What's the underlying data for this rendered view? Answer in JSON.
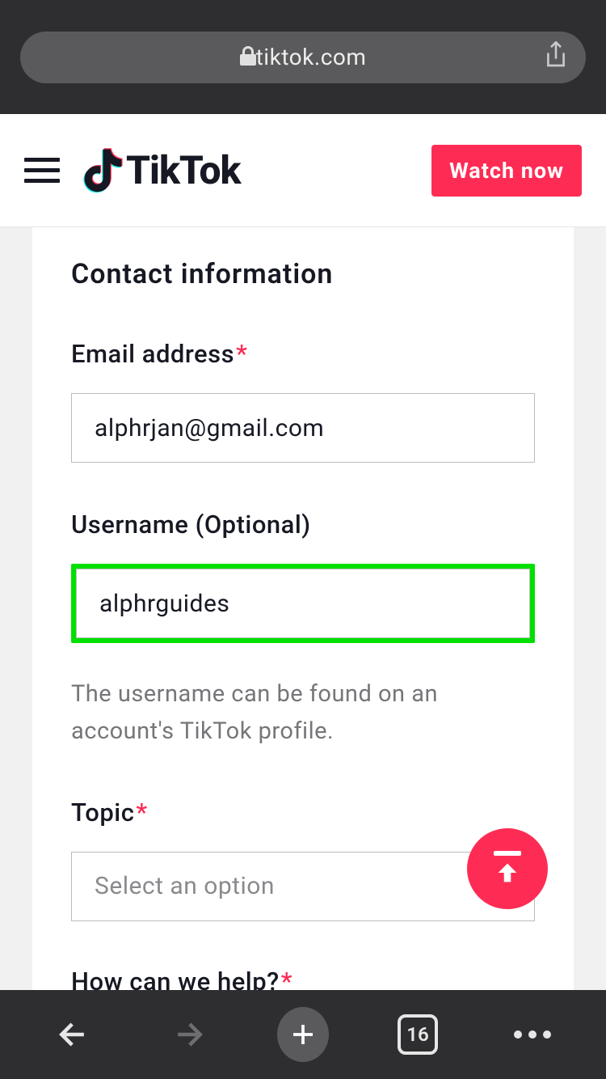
{
  "browser": {
    "domain": "tiktok.com",
    "tab_count": "16"
  },
  "header": {
    "brand": "TikTok",
    "cta": "Watch now"
  },
  "form": {
    "section_title": "Contact information",
    "email": {
      "label": "Email address",
      "value": "alphrjan@gmail.com"
    },
    "username": {
      "label": "Username (Optional)",
      "value": "alphrguides",
      "helper": "The username can be found on an account's TikTok profile."
    },
    "topic": {
      "label": "Topic",
      "placeholder": "Select an option"
    },
    "help": {
      "label": "How can we help?"
    }
  }
}
